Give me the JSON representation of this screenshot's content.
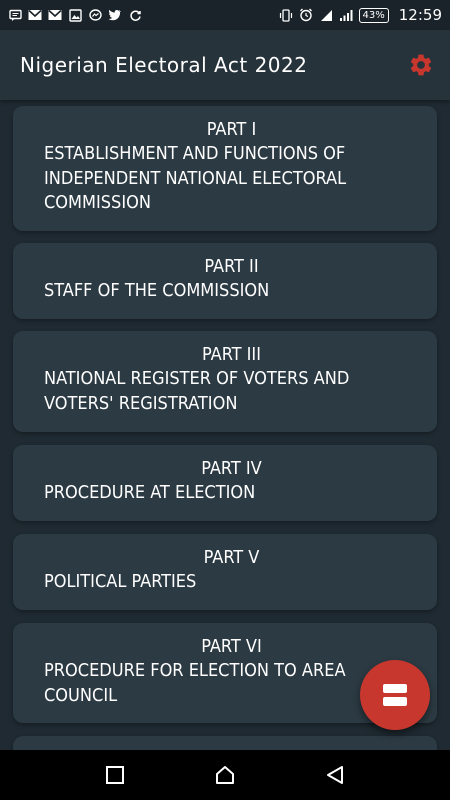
{
  "status_bar": {
    "time": "12:59",
    "battery": "43%",
    "left_icons": [
      "message-icon",
      "gmail-icon",
      "gmail-icon",
      "image-icon",
      "messenger-icon",
      "twitter-icon",
      "sync-icon"
    ],
    "right_icons": [
      "vibrate-icon",
      "alarm-icon",
      "wifi-icon",
      "signal-icon",
      "battery-icon"
    ]
  },
  "app_bar": {
    "title": "Nigerian Electoral Act 2022",
    "settings_icon": "gear-icon"
  },
  "parts": [
    {
      "part": "PART I",
      "title": "ESTABLISHMENT AND FUNCTIONS OF INDEPENDENT NATIONAL ELECTORAL COMMISSION"
    },
    {
      "part": "PART II",
      "title": "STAFF OF THE COMMISSION"
    },
    {
      "part": "PART III",
      "title": "NATIONAL REGISTER OF VOTERS AND VOTERS' REGISTRATION"
    },
    {
      "part": "PART IV",
      "title": "PROCEDURE AT ELECTION"
    },
    {
      "part": "PART V",
      "title": "POLITICAL PARTIES"
    },
    {
      "part": "PART VI",
      "title": "PROCEDURE FOR ELECTION TO AREA COUNCIL"
    }
  ],
  "fab": {
    "icon": "menu-toggle-icon"
  },
  "nav_bar": {
    "icons": [
      "recent-apps-icon",
      "home-icon",
      "back-icon"
    ]
  },
  "colors": {
    "background": "#1f2a32",
    "card": "#2c3a43",
    "app_bar": "#27333b",
    "accent": "#c8372d",
    "text": "#ffffff"
  }
}
